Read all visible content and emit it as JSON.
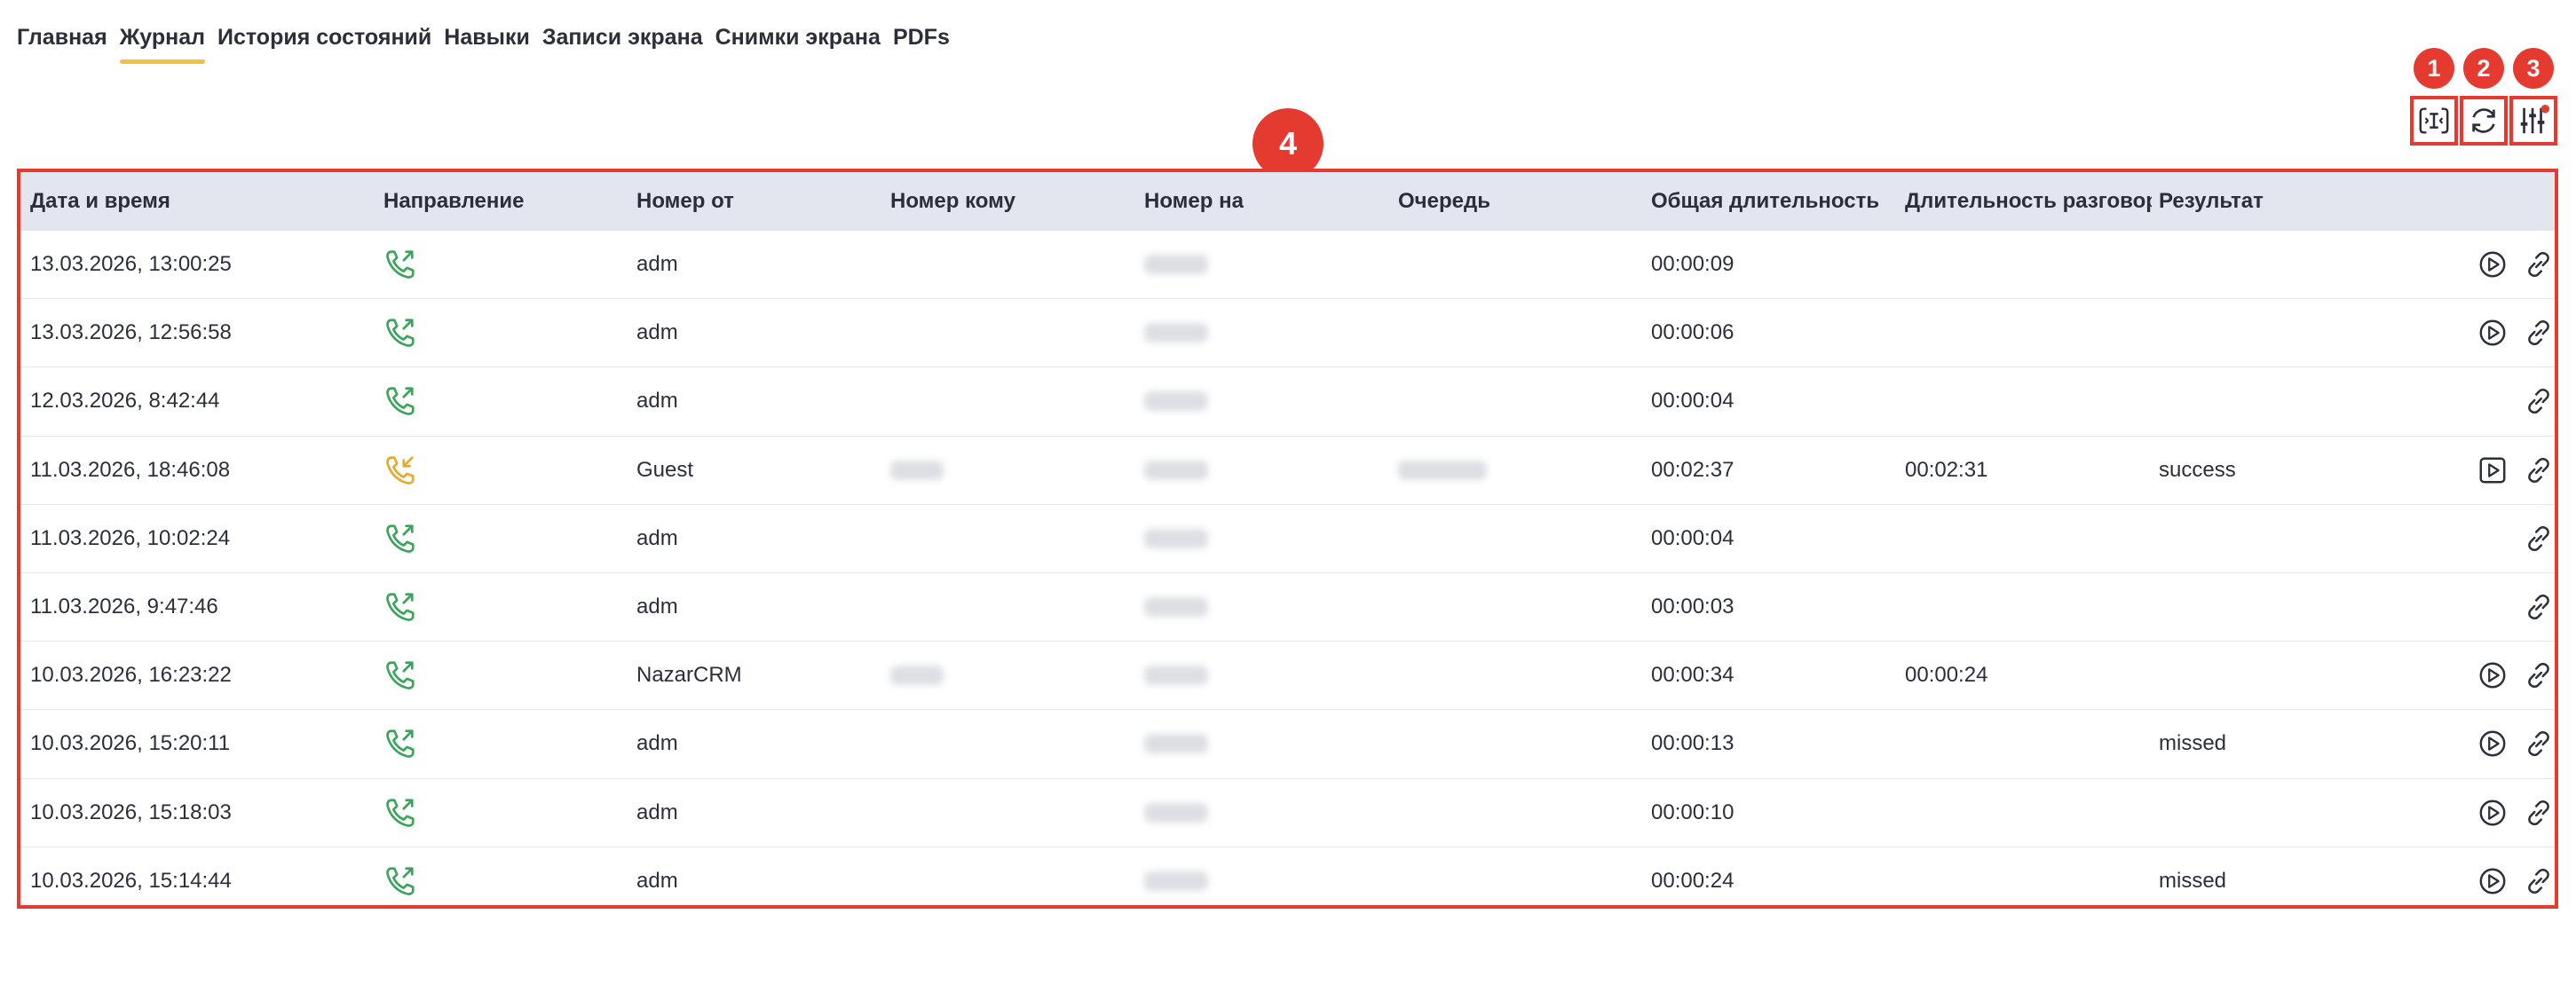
{
  "tabs": [
    {
      "label": "Главная",
      "active": false
    },
    {
      "label": "Журнал",
      "active": true
    },
    {
      "label": "История состояний",
      "active": false
    },
    {
      "label": "Навыки",
      "active": false
    },
    {
      "label": "Записи экрана",
      "active": false
    },
    {
      "label": "Снимки экрана",
      "active": false
    },
    {
      "label": "PDFs",
      "active": false
    }
  ],
  "toolbar": {
    "badges": [
      "1",
      "2",
      "3"
    ],
    "buttons": [
      {
        "icon": "resize-columns-icon"
      },
      {
        "icon": "refresh-icon"
      },
      {
        "icon": "column-settings-icon"
      }
    ]
  },
  "table_badge": "4",
  "colors": {
    "accent": "#f0c23e",
    "highlight": "#e53a2f",
    "outgoing": "#3aa55a",
    "incoming": "#e6a92a",
    "header_bg": "#e3e6ee"
  },
  "table": {
    "columns": [
      "Дата и время",
      "Направление",
      "Номер от",
      "Номер кому",
      "Номер на",
      "Очередь",
      "Общая длительность",
      "Длительность разговора",
      "Результат"
    ],
    "rows": [
      {
        "datetime": "13.03.2026, 13:00:25",
        "direction": "outgoing",
        "from": "adm",
        "to": "",
        "on": "blurred",
        "queue": "",
        "total": "00:00:09",
        "talk": "",
        "result": "",
        "actions": [
          "play-icon",
          "link-icon"
        ]
      },
      {
        "datetime": "13.03.2026, 12:56:58",
        "direction": "outgoing",
        "from": "adm",
        "to": "",
        "on": "blurred",
        "queue": "",
        "total": "00:00:06",
        "talk": "",
        "result": "",
        "actions": [
          "play-icon",
          "link-icon"
        ]
      },
      {
        "datetime": "12.03.2026, 8:42:44",
        "direction": "outgoing",
        "from": "adm",
        "to": "",
        "on": "blurred",
        "queue": "",
        "total": "00:00:04",
        "talk": "",
        "result": "",
        "actions": [
          "link-icon"
        ]
      },
      {
        "datetime": "11.03.2026, 18:46:08",
        "direction": "incoming",
        "from": "Guest",
        "to": "blurred",
        "on": "blurred",
        "queue": "blurred",
        "total": "00:02:37",
        "talk": "00:02:31",
        "result": "success",
        "actions": [
          "video-play-icon",
          "link-icon"
        ]
      },
      {
        "datetime": "11.03.2026, 10:02:24",
        "direction": "outgoing",
        "from": "adm",
        "to": "",
        "on": "blurred",
        "queue": "",
        "total": "00:00:04",
        "talk": "",
        "result": "",
        "actions": [
          "link-icon"
        ]
      },
      {
        "datetime": "11.03.2026, 9:47:46",
        "direction": "outgoing",
        "from": "adm",
        "to": "",
        "on": "blurred",
        "queue": "",
        "total": "00:00:03",
        "talk": "",
        "result": "",
        "actions": [
          "link-icon"
        ]
      },
      {
        "datetime": "10.03.2026, 16:23:22",
        "direction": "outgoing",
        "from": "NazarCRM",
        "to": "blurred",
        "on": "blurred",
        "queue": "",
        "total": "00:00:34",
        "talk": "00:00:24",
        "result": "",
        "actions": [
          "play-icon",
          "link-icon"
        ]
      },
      {
        "datetime": "10.03.2026, 15:20:11",
        "direction": "outgoing",
        "from": "adm",
        "to": "",
        "on": "blurred",
        "queue": "",
        "total": "00:00:13",
        "talk": "",
        "result": "missed",
        "actions": [
          "play-icon",
          "link-icon"
        ]
      },
      {
        "datetime": "10.03.2026, 15:18:03",
        "direction": "outgoing",
        "from": "adm",
        "to": "",
        "on": "blurred",
        "queue": "",
        "total": "00:00:10",
        "talk": "",
        "result": "",
        "actions": [
          "play-icon",
          "link-icon"
        ]
      },
      {
        "datetime": "10.03.2026, 15:14:44",
        "direction": "outgoing",
        "from": "adm",
        "to": "",
        "on": "blurred",
        "queue": "",
        "total": "00:00:24",
        "talk": "",
        "result": "missed",
        "actions": [
          "play-icon",
          "link-icon"
        ]
      }
    ]
  }
}
